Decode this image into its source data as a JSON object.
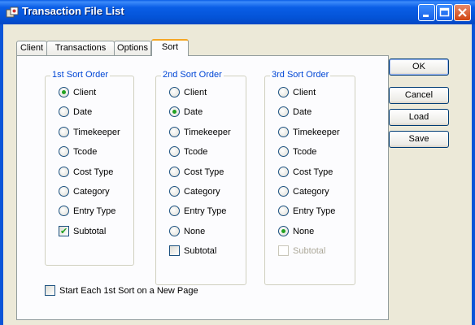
{
  "window": {
    "title": "Transaction File List"
  },
  "tabs": [
    "Client",
    "Transactions",
    "Options",
    "Sort"
  ],
  "active_tab": "Sort",
  "groups": [
    {
      "title": "1st Sort Order",
      "options": [
        "Client",
        "Date",
        "Timekeeper",
        "Tcode",
        "Cost Type",
        "Category",
        "Entry Type"
      ],
      "selected": "Client",
      "subtotal": {
        "label": "Subtotal",
        "checked": true,
        "enabled": true
      }
    },
    {
      "title": "2nd Sort Order",
      "options": [
        "Client",
        "Date",
        "Timekeeper",
        "Tcode",
        "Cost Type",
        "Category",
        "Entry Type",
        "None"
      ],
      "selected": "Date",
      "subtotal": {
        "label": "Subtotal",
        "checked": false,
        "enabled": true
      }
    },
    {
      "title": "3rd Sort Order",
      "options": [
        "Client",
        "Date",
        "Timekeeper",
        "Tcode",
        "Cost Type",
        "Category",
        "Entry Type",
        "None"
      ],
      "selected": "None",
      "subtotal": {
        "label": "Subtotal",
        "checked": false,
        "enabled": false
      }
    }
  ],
  "new_page_checkbox": {
    "label": "Start Each 1st Sort on a New Page",
    "checked": false
  },
  "buttons": {
    "ok": "OK",
    "cancel": "Cancel",
    "load": "Load",
    "save": "Save"
  }
}
